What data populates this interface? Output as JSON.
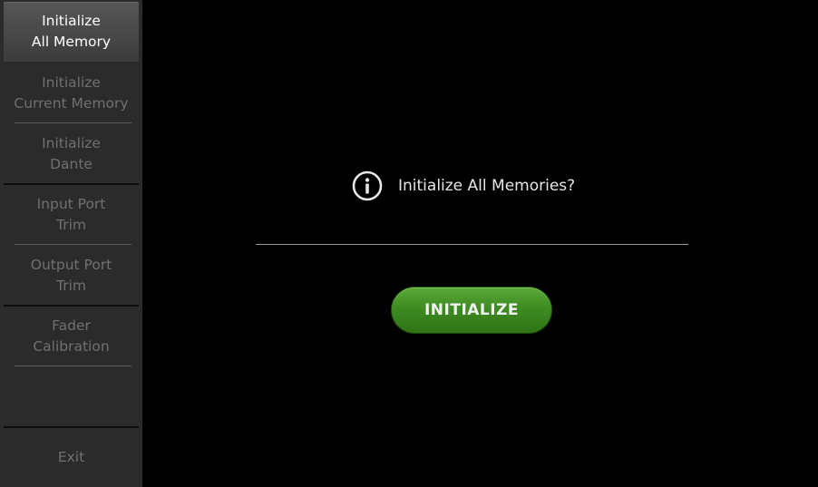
{
  "sidebar": {
    "items": [
      {
        "label": "Initialize\nAll Memory",
        "active": true
      },
      {
        "label": "Initialize\nCurrent Memory",
        "active": false
      },
      {
        "label": "Initialize\nDante",
        "active": false
      },
      {
        "label": "Input Port\nTrim",
        "active": false
      },
      {
        "label": "Output Port\nTrim",
        "active": false
      },
      {
        "label": "Fader\nCalibration",
        "active": false
      }
    ],
    "exit_label": "Exit"
  },
  "main": {
    "prompt_icon": "info-circle-icon",
    "prompt_text": "Initialize All Memories?",
    "initialize_button_label": "INITIALIZE"
  },
  "colors": {
    "background": "#000000",
    "sidebar": "#2b2b2b",
    "active_item_text": "#ffffff",
    "inactive_item_text": "#707070",
    "button_green": "#3f8c22"
  }
}
